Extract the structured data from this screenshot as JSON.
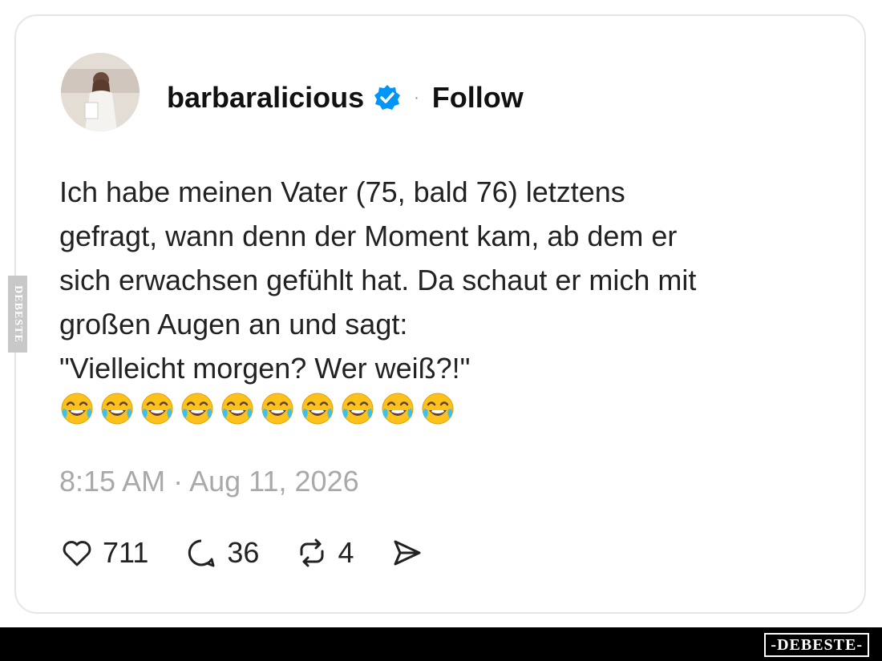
{
  "post": {
    "username": "barbaralicious",
    "separator": "·",
    "follow_label": "Follow",
    "text": "Ich habe meinen Vater (75, bald 76) letztens\ngefragt, wann denn der Moment kam, ab dem er\nsich erwachsen gefühlt hat. Da schaut er mich mit\ngroßen Augen an und sagt:\n\"Vielleicht morgen? Wer weiß?!\"",
    "emoji_icon": "face-with-tears-of-joy",
    "emoji_count": 10,
    "timestamp": "8:15 AM · Aug 11, 2026"
  },
  "actions": {
    "likes": "711",
    "replies": "36",
    "reposts": "4"
  },
  "watermarks": {
    "bottom": "-DEBESTE-",
    "side": "DEBESTE"
  },
  "colors": {
    "verified": "#0095f6",
    "timestamp": "#a9a9a9",
    "footer": "#000000"
  }
}
